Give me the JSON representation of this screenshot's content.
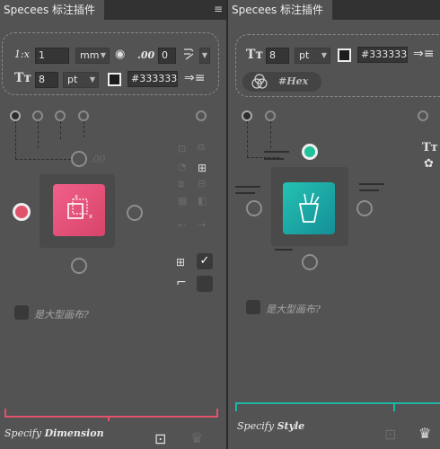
{
  "left_panel": {
    "tab_title": "Specees 标注插件",
    "menu_icon": "hamburger-icon",
    "units_label": "1:x",
    "scale_value": "1",
    "unit_value": "mm",
    "decimal_label": ".00",
    "decimal_value": "0",
    "font_size_value": "8",
    "font_unit_value": "pt",
    "color_hex": "#333333",
    "color_swatch": "#1c1c1c",
    "ghost_value": ".00",
    "accent_color": "#e0536b",
    "checkbox_label": "是大型画布?",
    "footer_prefix": "Specify",
    "footer_bold": "Dimension"
  },
  "right_panel": {
    "tab_title": "Specees 标注插件",
    "font_size_value": "8",
    "font_unit_value": "pt",
    "color_hex": "#333333",
    "color_swatch": "#1c1c1c",
    "hex_label": "#Hex",
    "accent_color": "#1fb6a6",
    "checkbox_label": "是大型画布?",
    "footer_prefix": "Specify",
    "footer_bold": "Style"
  }
}
